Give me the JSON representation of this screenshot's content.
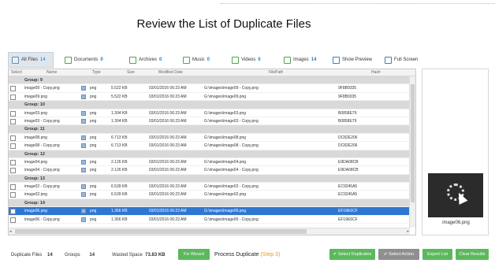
{
  "page": {
    "heading": "Review the List of Duplicate Files"
  },
  "tabs": [
    {
      "label": "All Files",
      "count": "14",
      "active": true
    },
    {
      "label": "Documents",
      "count": "0"
    },
    {
      "label": "Archives",
      "count": "0"
    },
    {
      "label": "Music",
      "count": "0"
    },
    {
      "label": "Videos",
      "count": "0"
    },
    {
      "label": "Images",
      "count": "14"
    }
  ],
  "toolbar": {
    "show_preview": "Show Preview",
    "full_screen": "Full Screen"
  },
  "table": {
    "headers": {
      "select": "Select",
      "name": "Name",
      "type": "Type",
      "size": "Size",
      "modified": "Modified Date",
      "path": "FilePath",
      "hash": "Hash"
    },
    "rows": [
      {
        "kind": "group",
        "label": "Group:  9"
      },
      {
        "kind": "file",
        "name": "image09 - Copy.png",
        "type": "png",
        "size": "5.522 KB",
        "modified": "03/01/2016 06:23 AM",
        "path": "G:\\images\\image09 - Copy.png",
        "hash": "9F8B9335"
      },
      {
        "kind": "file",
        "name": "image09.png",
        "type": "png",
        "size": "5.522 KB",
        "modified": "03/01/2016 06:23 AM",
        "path": "G:\\images\\image09.png",
        "hash": "9F8B9335"
      },
      {
        "kind": "group",
        "label": "Group:  10"
      },
      {
        "kind": "file",
        "name": "image03.png",
        "type": "png",
        "size": "1.304 KB",
        "modified": "03/01/2016 06:23 AM",
        "path": "G:\\images\\image03.png",
        "hash": "B0858E79"
      },
      {
        "kind": "file",
        "name": "image03 - Copy.png",
        "type": "png",
        "size": "1.304 KB",
        "modified": "03/01/2016 06:23 AM",
        "path": "G:\\images\\image03 - Copy.png",
        "hash": "B0858E79"
      },
      {
        "kind": "group",
        "label": "Group:  11"
      },
      {
        "kind": "file",
        "name": "image08.png",
        "type": "png",
        "size": "6.713 KB",
        "modified": "03/01/2016 06:23 AM",
        "path": "G:\\images\\image08.png",
        "hash": "DC82E206"
      },
      {
        "kind": "file",
        "name": "image08 - Copy.png",
        "type": "png",
        "size": "6.713 KB",
        "modified": "03/01/2016 06:23 AM",
        "path": "G:\\images\\image08 - Copy.png",
        "hash": "DC82E206"
      },
      {
        "kind": "group",
        "label": "Group:  12"
      },
      {
        "kind": "file",
        "name": "image04.png",
        "type": "png",
        "size": "2.126 KB",
        "modified": "03/01/2016 06:23 AM",
        "path": "G:\\images\\image04.png",
        "hash": "E9DA08CB"
      },
      {
        "kind": "file",
        "name": "image04 - Copy.png",
        "type": "png",
        "size": "2.126 KB",
        "modified": "03/01/2016 06:23 AM",
        "path": "G:\\images\\image04 - Copy.png",
        "hash": "E9DA08CB"
      },
      {
        "kind": "group",
        "label": "Group:  13"
      },
      {
        "kind": "file",
        "name": "image02 - Copy.png",
        "type": "png",
        "size": "6.539 KB",
        "modified": "03/01/2016 06:23 AM",
        "path": "G:\\images\\image02 - Copy.png",
        "hash": "EC9245A5"
      },
      {
        "kind": "file",
        "name": "image02.png",
        "type": "png",
        "size": "6.539 KB",
        "modified": "03/01/2016 06:23 AM",
        "path": "G:\\images\\image02.png",
        "hash": "EC9245A5"
      },
      {
        "kind": "group",
        "label": "Group:  14"
      },
      {
        "kind": "file",
        "name": "image06.png",
        "type": "png",
        "size": "1.366 KB",
        "modified": "03/01/2016 06:23 AM",
        "path": "G:\\images\\image06.png",
        "hash": "EF19E6CF",
        "selected": true
      },
      {
        "kind": "file",
        "name": "image06 - Copy.png",
        "type": "png",
        "size": "1.366 KB",
        "modified": "03/01/2016 06:23 AM",
        "path": "G:\\images\\image06 - Copy.png",
        "hash": "EF19E6CF"
      }
    ]
  },
  "preview": {
    "filename": "image06.png"
  },
  "footer": {
    "duplicate_files_label": "Duplicate Files",
    "duplicate_files_value": "14",
    "groups_label": "Groups",
    "groups_value": "14",
    "wasted_space_label": "Wasted Space",
    "wasted_space_value": "73.83 KB",
    "fix_wizard": "Fix Wizard",
    "process_label": "Process Duplicate",
    "process_step": "(Step 3)",
    "select_duplicates": "Select Duplicates",
    "select_action": "Select Action",
    "export_list": "Export List",
    "clear_results": "Clear Results"
  }
}
